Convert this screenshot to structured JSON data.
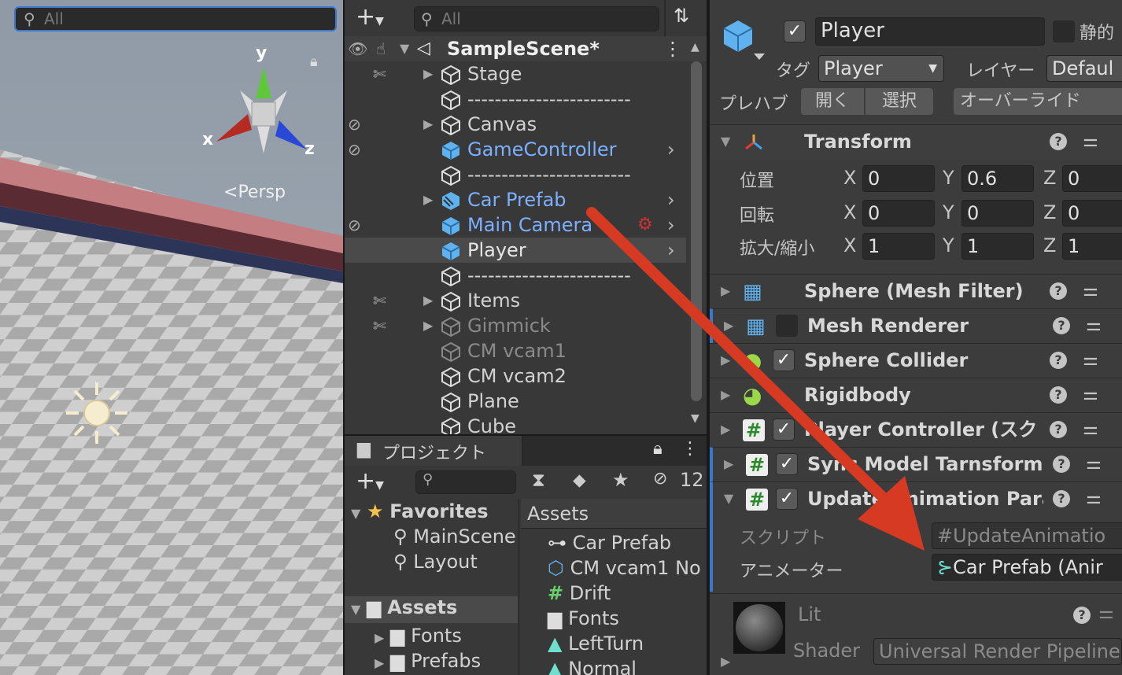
{
  "scene": {
    "search_placeholder": "All",
    "axis_y": "y",
    "axis_x": "x",
    "axis_z": "z",
    "persp_label": "Persp"
  },
  "hierarchy": {
    "search_placeholder": "All",
    "scene_name": "SampleScene*",
    "items": [
      {
        "label": "Stage"
      },
      {
        "label": "------------------------"
      },
      {
        "label": "Canvas"
      },
      {
        "label": "GameController"
      },
      {
        "label": "------------------------"
      },
      {
        "label": "Car Prefab"
      },
      {
        "label": "Main Camera"
      },
      {
        "label": "Player"
      },
      {
        "label": "------------------------"
      },
      {
        "label": "Items"
      },
      {
        "label": "Gimmick"
      },
      {
        "label": "CM vcam1"
      },
      {
        "label": "CM vcam2"
      },
      {
        "label": "Plane"
      },
      {
        "label": "Cube"
      }
    ]
  },
  "project": {
    "tab_label": "プロジェクト",
    "hidden_count": "12",
    "favorites_label": "Favorites",
    "favorites": [
      "MainScene",
      "Layout"
    ],
    "assets_label": "Assets",
    "asset_folders": [
      "Fonts",
      "Prefabs"
    ],
    "assets_header": "Assets",
    "asset_items": [
      "Car Prefab",
      "CM vcam1 No",
      "Drift",
      "Fonts",
      "LeftTurn",
      "Normal"
    ]
  },
  "inspector": {
    "object_name": "Player",
    "static_label": "静的",
    "tag_label": "タグ",
    "tag_value": "Player",
    "layer_label": "レイヤー",
    "layer_value": "Defaul",
    "prefab_label": "プレハブ",
    "open_label": "開く",
    "select_label": "選択",
    "override_label": "オーバーライド",
    "transform": {
      "title": "Transform",
      "position_label": "位置",
      "rotation_label": "回転",
      "scale_label": "拡大/縮小",
      "x": "X",
      "y": "Y",
      "z": "Z",
      "position": {
        "x": "0",
        "y": "0.6",
        "z": "0"
      },
      "rotation": {
        "x": "0",
        "y": "0",
        "z": "0"
      },
      "scale": {
        "x": "1",
        "y": "1",
        "z": "1"
      }
    },
    "components": [
      {
        "name": "Sphere (Mesh Filter)"
      },
      {
        "name": "Mesh Renderer"
      },
      {
        "name": "Sphere Collider"
      },
      {
        "name": "Rigidbody"
      },
      {
        "name": "Player Controller (スクリ"
      },
      {
        "name": "Sync Model Tarnsform"
      },
      {
        "name": "Update Animation Para"
      }
    ],
    "script_label": "スクリプト",
    "script_value": "UpdateAnimatio",
    "animator_label": "アニメーター",
    "animator_value": "Car Prefab (Anir",
    "material_name": "Lit",
    "shader_label": "Shader",
    "shader_value": "Universal Render Pipeline"
  },
  "colors": {
    "accent_blue": "#3d78c8",
    "prefab_blue": "#7cb0ff",
    "annotation_arrow": "#d63a22"
  }
}
